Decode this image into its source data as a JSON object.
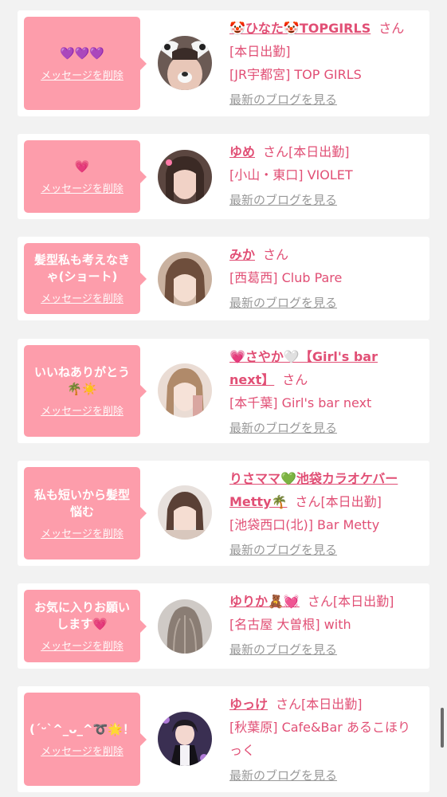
{
  "colors": {
    "accent": "#e14f75",
    "bubble": "#fd9dab",
    "link_gray": "#999999",
    "background": "#f2f2f2"
  },
  "suffix_san": "さん",
  "delete_label": "メッセージを削除",
  "blog_label": "最新のブログを見る",
  "cards": [
    {
      "message": "💜💜💜",
      "name": "🤡ひなた🤡TOPGIRLS",
      "status": "[本日出勤]",
      "area": "[JR宇都宮] TOP GIRLS",
      "avatar_icon": "dog-filter-photo"
    },
    {
      "message": "💗",
      "name": "ゆめ",
      "status": "[本日出勤]",
      "area": "[小山・東口] VIOLET",
      "avatar_icon": "girl-selfie-photo"
    },
    {
      "message": "髪型私も考えなきゃ(ショート)",
      "name": "みか",
      "status": "",
      "area": "[西葛西] Club Pare",
      "avatar_icon": "girl-selfie-photo"
    },
    {
      "message": "いいねありがとう🌴☀️",
      "name": "💗さやか🤍【Girl's bar next】",
      "status": "",
      "area": "[本千葉] Girl's bar next",
      "avatar_icon": "girl-selfie-photo"
    },
    {
      "message": "私も短いから髪型悩む",
      "name": "りさママ💚池袋カラオケバーMetty🌴",
      "status": "[本日出勤]",
      "area": "[池袋西口(北)] Bar Metty",
      "avatar_icon": "girl-selfie-photo"
    },
    {
      "message": "お気に入りお願いします💗",
      "name": "ゆりか🧸💓",
      "status": "[本日出勤]",
      "area": "[名古屋 大曽根] with",
      "avatar_icon": "hair-back-photo"
    },
    {
      "message": "(ˊᵕˋ^_ᴗ_^➰🌟！",
      "name": "ゆっけ",
      "status": "[本日出勤]",
      "area": "[秋葉原] Cafe&Bar あるこほりっく",
      "avatar_icon": "maid-costume-photo"
    }
  ]
}
